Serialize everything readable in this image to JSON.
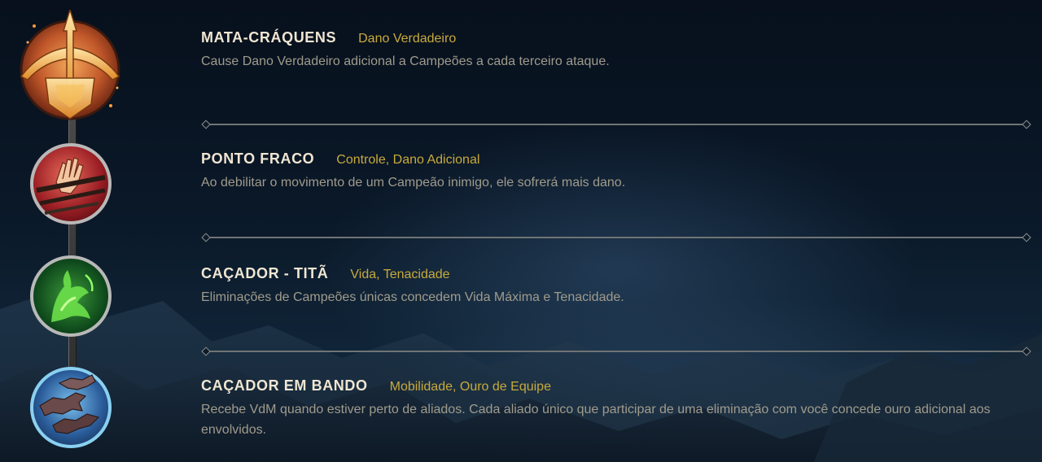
{
  "runes": [
    {
      "icon": "crossbow-icon",
      "name": "MATA-CRÁQUENS",
      "tags": "Dano Verdadeiro",
      "description": "Cause Dano Verdadeiro adicional a Campeões a cada terceiro ataque.",
      "accent": "#e8872a"
    },
    {
      "icon": "bound-hand-icon",
      "name": "PONTO FRACO",
      "tags": "Controle, Dano Adicional",
      "description": "Ao debilitar o movimento de um Campeão inimigo, ele sofrerá mais dano.",
      "accent": "#c0303a"
    },
    {
      "icon": "titan-claw-icon",
      "name": "CAÇADOR - TITÃ",
      "tags": "Vida, Tenacidade",
      "description": "Eliminações de Campeões únicas concedem Vida Máxima e Tenacidade.",
      "accent": "#4fc84a"
    },
    {
      "icon": "wolf-pack-icon",
      "name": "CAÇADOR EM BANDO",
      "tags": "Mobilidade, Ouro de Equipe",
      "description": "Recebe VdM quando estiver perto de aliados. Cada aliado único que participar de uma eliminação com você concede ouro adicional aos envolvidos.",
      "accent": "#6ab8e8"
    }
  ],
  "colors": {
    "title": "#f0e6d2",
    "tags": "#c8aa3c",
    "description": "#a09b8c",
    "divider": "#6f7474"
  }
}
